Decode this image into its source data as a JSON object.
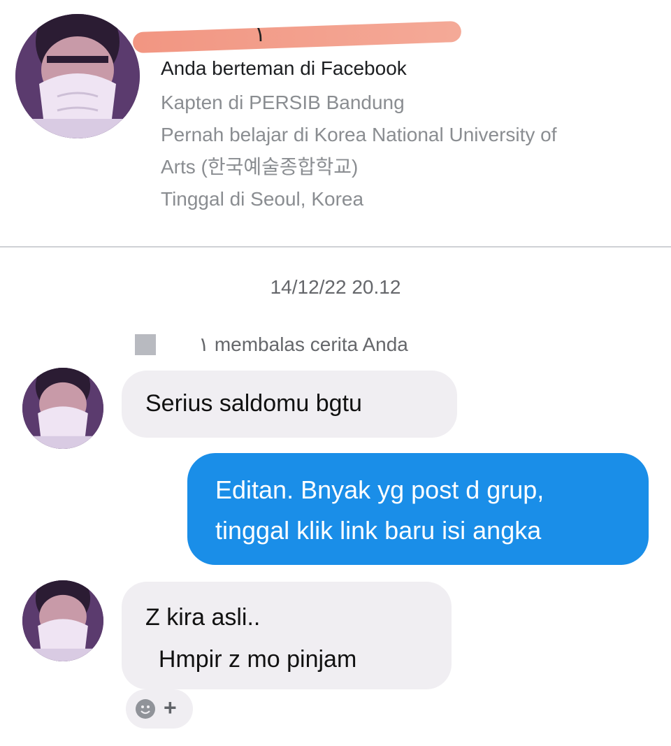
{
  "profile": {
    "name_visible": "١",
    "friend_status": "Anda berteman di Facebook",
    "info_lines": [
      "Kapten di PERSIB Bandung",
      "Pernah belajar di Korea National University of",
      "Arts (한국예술종합학교)",
      "Tinggal di Seoul, Korea"
    ]
  },
  "conversation": {
    "timestamp": "14/12/22 20.12",
    "reply_notice": "١ membalas cerita Anda",
    "messages": [
      {
        "direction": "incoming",
        "lines": [
          "Serius saldomu bgtu"
        ]
      },
      {
        "direction": "outgoing",
        "lines": [
          "Editan. Bnyak yg post d grup,",
          "tinggal klik link baru isi angka"
        ]
      },
      {
        "direction": "incoming",
        "lines": [
          "Z kira asli..",
          "  Hmpir z mo pinjam"
        ]
      }
    ],
    "reaction_button": {
      "icon": "smile-icon",
      "plus": "+"
    }
  },
  "colors": {
    "outgoing_bubble": "#1a8ee8",
    "incoming_bubble": "#f0eef2",
    "redaction": "#f08a74"
  }
}
